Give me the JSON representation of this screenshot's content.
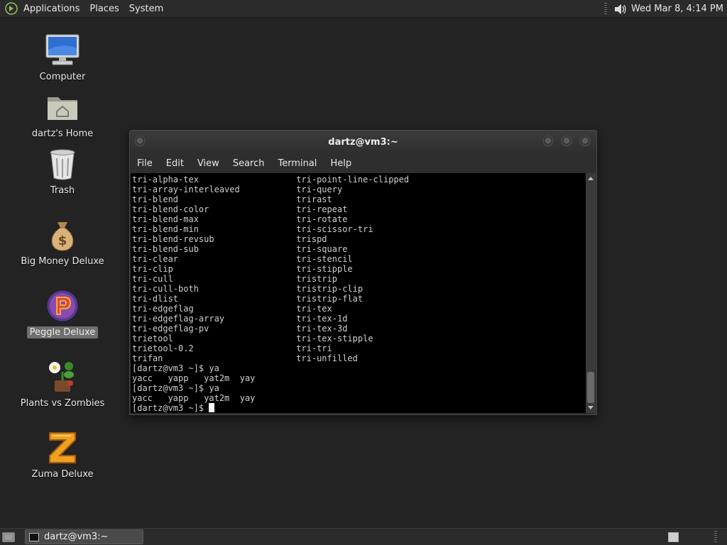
{
  "top_panel": {
    "menus": [
      "Applications",
      "Places",
      "System"
    ],
    "clock": "Wed Mar  8,  4:14 PM"
  },
  "desktop_icons": [
    {
      "label": "Computer",
      "icon": "computer-icon"
    },
    {
      "label": "dartz's Home",
      "icon": "home-folder-icon"
    },
    {
      "label": "Trash",
      "icon": "trash-icon"
    },
    {
      "label": "Big Money Deluxe",
      "icon": "money-bag-icon"
    },
    {
      "label": "Peggle Deluxe",
      "icon": "peggle-icon",
      "selected": true
    },
    {
      "label": "Plants vs Zombies",
      "icon": "plants-vs-zombies-icon"
    },
    {
      "label": "Zuma Deluxe",
      "icon": "zuma-icon"
    }
  ],
  "terminal": {
    "title": "dartz@vm3:~",
    "menus": [
      "File",
      "Edit",
      "View",
      "Search",
      "Terminal",
      "Help"
    ],
    "columns_left": [
      "tri-alpha-tex",
      "tri-array-interleaved",
      "tri-blend",
      "tri-blend-color",
      "tri-blend-max",
      "tri-blend-min",
      "tri-blend-revsub",
      "tri-blend-sub",
      "tri-clear",
      "tri-clip",
      "tri-cull",
      "tri-cull-both",
      "tri-dlist",
      "tri-edgeflag",
      "tri-edgeflag-array",
      "tri-edgeflag-pv",
      "trietool",
      "trietool-0.2",
      "trifan"
    ],
    "columns_right": [
      "tri-point-line-clipped",
      "tri-query",
      "trirast",
      "tri-repeat",
      "tri-rotate",
      "tri-scissor-tri",
      "trispd",
      "tri-square",
      "tri-stencil",
      "tri-stipple",
      "tristrip",
      "tristrip-clip",
      "tristrip-flat",
      "tri-tex",
      "tri-tex-1d",
      "tri-tex-3d",
      "tri-tex-stipple",
      "tri-tri",
      "tri-unfilled"
    ],
    "tail_lines": [
      "[dartz@vm3 ~]$ ya",
      "yacc   yapp   yat2m  yay",
      "[dartz@vm3 ~]$ ya",
      "yacc   yapp   yat2m  yay"
    ],
    "prompt": "[dartz@vm3 ~]$ "
  },
  "taskbar": {
    "task_label": "dartz@vm3:~"
  }
}
